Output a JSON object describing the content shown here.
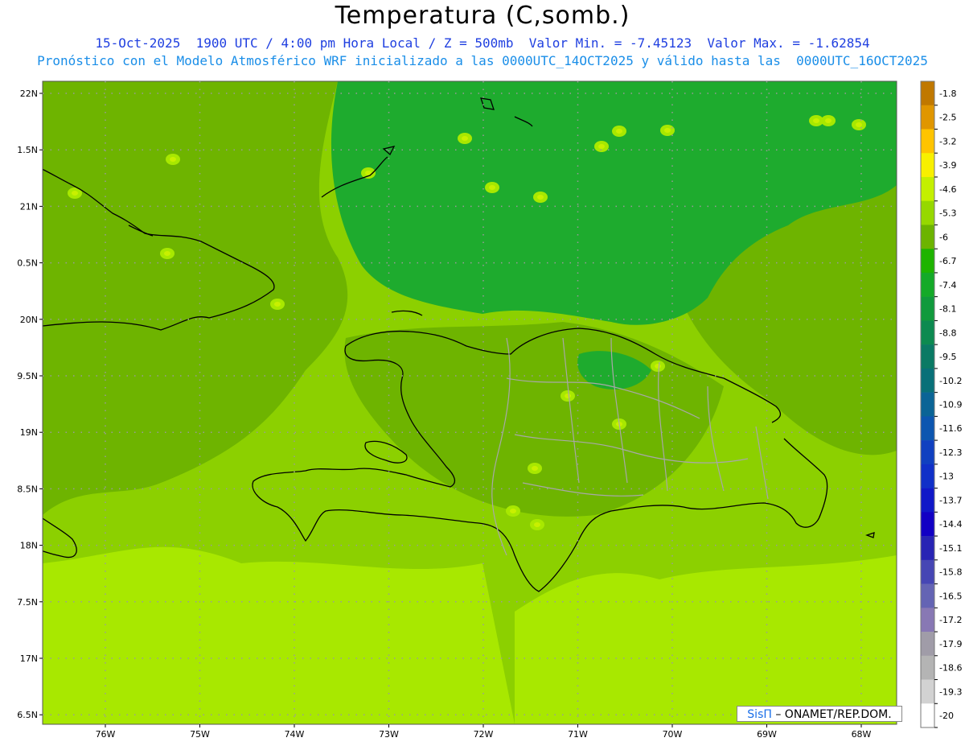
{
  "header": {
    "title": "Temperatura (C,somb.)",
    "line1": "15-Oct-2025  1900 UTC / 4:00 pm Hora Local / Z = 500mb  Valor Min. = -7.45123  Valor Max. = -1.62854",
    "line2": "Pronóstico con el Modelo Atmosférico WRF inicializado a las 0000UTC_14OCT2025 y válido hasta las  0000UTC_16OCT2025"
  },
  "credit": {
    "brand": "SisΠ",
    "org": "– ONAMET/REP.DOM."
  },
  "map_data": {
    "lat_ticks": [
      "22N",
      "1.5N",
      "21N",
      "0.5N",
      "20N",
      "9.5N",
      "19N",
      "8.5N",
      "18N",
      "7.5N",
      "17N",
      "6.5N"
    ],
    "lon_ticks": [
      "76W",
      "75W",
      "74W",
      "73W",
      "72W",
      "71W",
      "70W",
      "69W",
      "68W"
    ],
    "legend": {
      "labels": [
        "-1.8",
        "-2.5",
        "-3.2",
        "-3.9",
        "-4.6",
        "-5.3",
        "-6",
        "-6.7",
        "-7.4",
        "-8.1",
        "-8.8",
        "-9.5",
        "-10.2",
        "-10.9",
        "-11.6",
        "-12.3",
        "-13",
        "-13.7",
        "-14.4",
        "-15.1",
        "-15.8",
        "-16.5",
        "-17.2",
        "-17.9",
        "-18.6",
        "-19.3",
        "-20"
      ],
      "colors": [
        "#c07800",
        "#e09600",
        "#ffc400",
        "#f8f000",
        "#c4f000",
        "#96d800",
        "#6cb400",
        "#1eb400",
        "#14aa28",
        "#109a3c",
        "#0c8a50",
        "#0a7a64",
        "#087078",
        "#0a6496",
        "#0c56b0",
        "#1040c0",
        "#1030c8",
        "#1018c8",
        "#1200c4",
        "#2824b4",
        "#4646b4",
        "#6464b4",
        "#8878b4",
        "#a09ca8",
        "#b4b4b4",
        "#d2d2d2",
        "#ffffff"
      ]
    },
    "field_colors": {
      "base": "#8cd000",
      "mid": "#6eb400",
      "dark": "#1eab2e",
      "light": "#a8e800",
      "hot": "#c8f000"
    }
  }
}
